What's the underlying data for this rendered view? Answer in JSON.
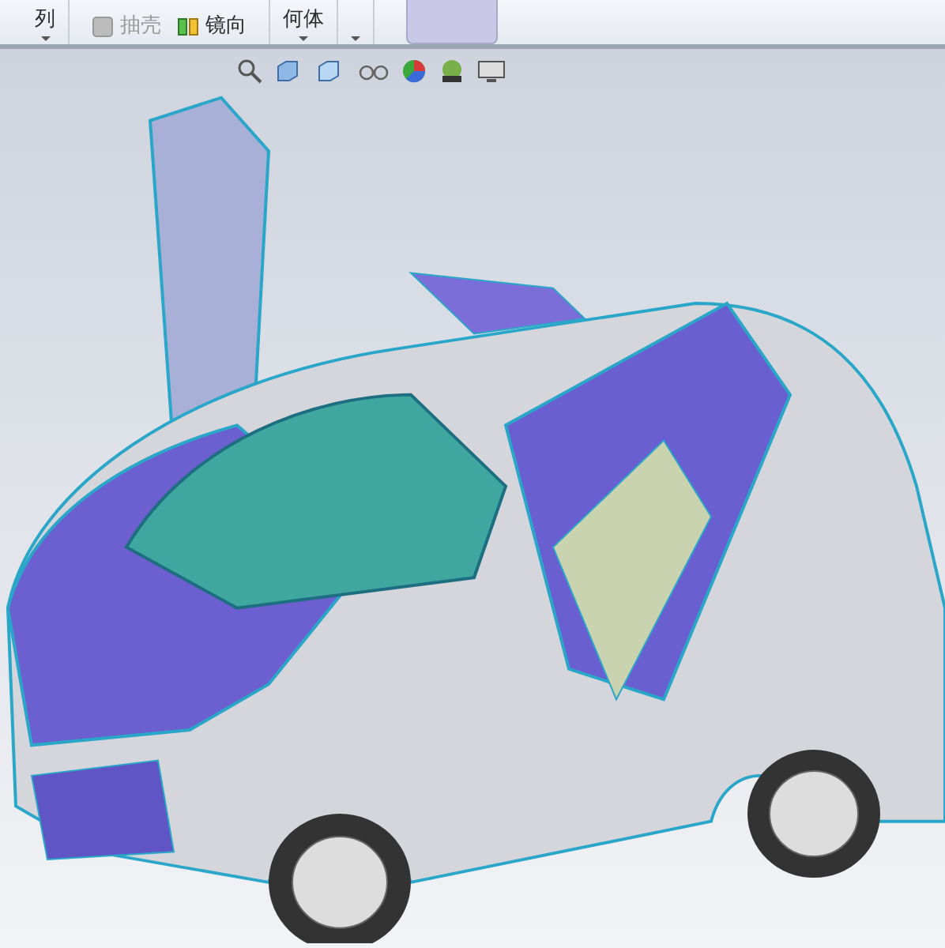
{
  "ribbon": {
    "groups": [
      {
        "kind": "dropdown",
        "label": "列"
      },
      {
        "kind": "tools",
        "tools": [
          {
            "label": "抽壳",
            "disabled": true
          },
          {
            "label": "镜向",
            "disabled": false
          }
        ]
      },
      {
        "kind": "dropdown",
        "label": "何体"
      },
      {
        "kind": "caret"
      },
      {
        "kind": "panel"
      }
    ]
  }
}
